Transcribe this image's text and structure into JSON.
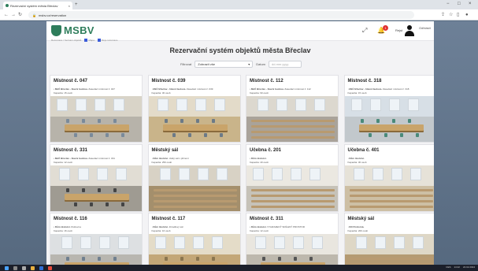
{
  "browser": {
    "tab_title": "Rezervační systém města Břeclav",
    "tab_close": "×",
    "new_tab": "+",
    "url": "msbv.cz/reservation",
    "win_min": "−",
    "win_max": "□",
    "win_close": "×"
  },
  "site": {
    "logo_text": "MSBV",
    "notification_count": "1",
    "lang_label": "Rejst",
    "logout_label": "Odhlásit",
    "subnav": [
      "Rezervace / Seznam objektů",
      "Mapa",
      "Moje rezervace"
    ]
  },
  "page_title": "Rezervační systém objektů města Břeclav",
  "filter": {
    "label": "Filtrovat",
    "selected": "Zobrazit vše",
    "date_label": "Datum",
    "date_placeholder": "dd.mm.yyyy"
  },
  "cards": [
    {
      "title": "Místnost č. 047",
      "desc_bold": "MěÚ Břeclav - hlavní budova.",
      "desc": " Zasedací místnost č. 047",
      "capacity": "Kapacita: 15 osob"
    },
    {
      "title": "Místnost č. 039",
      "desc_bold": "MěÚ Břeclav - hlavní budova.",
      "desc": " Zasedací místnost č. 039",
      "capacity": "Kapacita: 30 osob"
    },
    {
      "title": "Místnost č. 112",
      "desc_bold": "MěÚ Břeclav - hlavní budova.",
      "desc": " Zasedací místnost č. 112",
      "capacity": "Kapacita: 90 osob"
    },
    {
      "title": "Místnost č. 318",
      "desc_bold": "MěÚ Břeclav - hlavní budova.",
      "desc": " Zasedací místnost č. 318",
      "capacity": "Kapacita: 15 osob"
    },
    {
      "title": "Místnost č. 331",
      "desc_bold": "MěÚ Břeclav - hlavní budova.",
      "desc": " Zasedací místnost č. 331",
      "capacity": "Kapacita: 12 osob"
    },
    {
      "title": "Městský sál",
      "desc_bold": "Dům školství.",
      "desc": " Velký sál v přízemí",
      "capacity": "Kapacita: 250 osob"
    },
    {
      "title": "Učebna č. 201",
      "desc_bold": "Dům školství.",
      "desc": "",
      "capacity": "Kapacita: 40 osob"
    },
    {
      "title": "Učebna č. 401",
      "desc_bold": "Dům školství.",
      "desc": "",
      "capacity": "Kapacita: 30 osob"
    },
    {
      "title": "Místnost č. 116",
      "desc_bold": "Dům školství.",
      "desc": " Klubovna",
      "capacity": "Kapacita: 16 osob"
    },
    {
      "title": "Místnost č. 117",
      "desc_bold": "Dům školství.",
      "desc": " Zrcadlový sál",
      "capacity": "Kapacita: 16 osob"
    },
    {
      "title": "Místnost č. 311",
      "desc_bold": "Dům školství.",
      "desc": " VYHRAZENÝ SDÍLENÝ PROSTOR",
      "capacity": "Kapacita: 12 osob"
    },
    {
      "title": "Městský sál",
      "desc_bold": "KD Poštorná.",
      "desc": "",
      "capacity": "Kapacita: 200 osob"
    }
  ],
  "scroll_top_icon": "↑",
  "icons": [
    "favicon-icon",
    "back-arrow-icon",
    "forward-arrow-icon",
    "reload-icon",
    "lock-icon",
    "share-icon",
    "star-icon",
    "sidebar-icon",
    "profile-icon",
    "expand-icon",
    "bell-icon",
    "user-icon",
    "windows-start-icon",
    "search-icon",
    "taskview-icon"
  ],
  "colors": {
    "brand": "#2e7d5b",
    "fab": "#2563eb",
    "badge": "#e03131"
  },
  "taskbar": {
    "time": "14:22",
    "date": "22.02.2024",
    "lang": "CES"
  }
}
